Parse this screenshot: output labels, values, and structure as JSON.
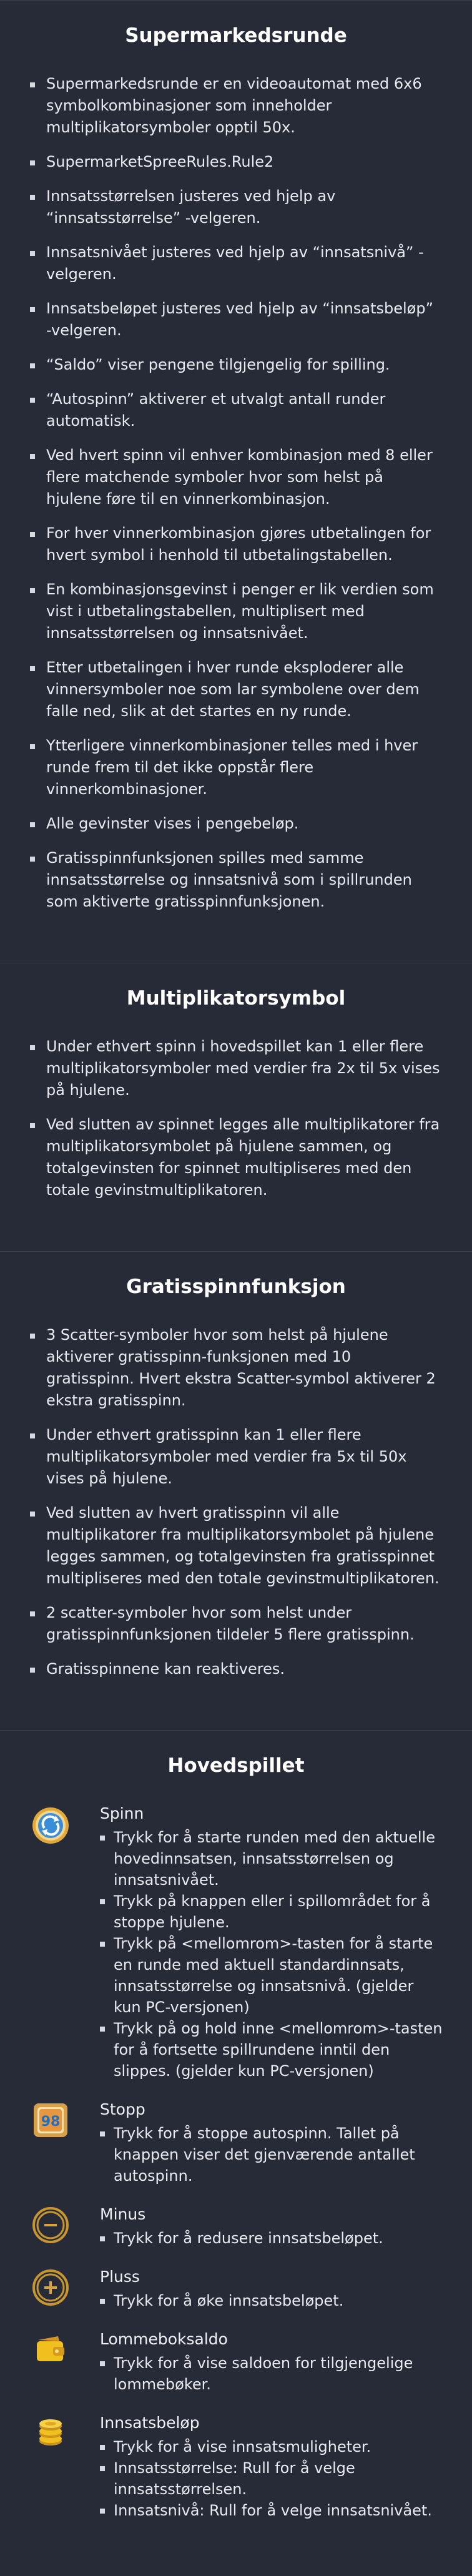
{
  "sections": [
    {
      "title": "Supermarkedsrunde",
      "rules": [
        "Supermarkedsrunde er en videoautomat med 6x6 symbolkombinasjoner som inneholder multiplikatorsymboler opptil 50x.",
        "SupermarketSpreeRules.Rule2",
        "Innsatsstørrelsen justeres ved hjelp av “innsatsstørrelse” -velgeren.",
        "Innsatsnivået justeres ved hjelp av “innsatsnivå” -velgeren.",
        "Innsatsbeløpet justeres ved hjelp av “innsatsbeløp” -velgeren.",
        "“Saldo” viser pengene tilgjengelig for spilling.",
        "“Autospinn” aktiverer et utvalgt antall runder automatisk.",
        "Ved hvert spinn vil enhver kombinasjon med 8 eller flere matchende symboler hvor som helst på hjulene føre til en vinnerkombinasjon.",
        "For hver vinnerkombinasjon gjøres utbetalingen for hvert symbol i henhold til utbetalingstabellen.",
        "En kombinasjonsgevinst i penger er lik verdien som vist i utbetalingstabellen, multiplisert med innsatsstørrelsen og innsatsnivået.",
        "Etter utbetalingen i hver runde eksploderer alle vinnersymboler noe som lar symbolene over dem falle ned, slik at det startes en ny runde.",
        "Ytterligere vinnerkombinasjoner telles med i hver runde frem til det ikke oppstår flere vinnerkombinasjoner.",
        "Alle gevinster vises i pengebeløp.",
        "Gratisspinnfunksjonen spilles med samme innsatsstørrelse og innsatsnivå som i spillrunden som aktiverte gratisspinnfunksjonen."
      ]
    },
    {
      "title": "Multiplikatorsymbol",
      "rules": [
        "Under ethvert spinn i hovedspillet kan 1 eller flere multiplikatorsymboler med verdier fra 2x til 5x vises på hjulene.",
        "Ved slutten av spinnet legges alle multiplikatorer fra multiplikatorsymbolet på hjulene sammen, og totalgevinsten for spinnet multipliseres med den totale gevinstmultiplikatoren."
      ]
    },
    {
      "title": "Gratisspinnfunksjon",
      "rules": [
        "3 Scatter-symboler hvor som helst på hjulene aktiverer gratisspinn-funksjonen med 10 gratisspinn. Hvert ekstra Scatter-symbol aktiverer 2 ekstra gratisspinn.",
        "Under ethvert gratisspinn kan 1 eller flere multiplikatorsymboler med verdier fra 5x til 50x vises på hjulene.",
        "Ved slutten av hvert gratisspinn vil alle multiplikatorer fra multiplikatorsymbolet på hjulene legges sammen, og totalgevinsten fra gratisspinnet multipliseres med den totale gevinstmultiplikatoren.",
        "2 scatter-symboler hvor som helst under gratisspinnfunksjonen tildeler 5 flere gratisspinn.",
        "Gratisspinnene kan reaktiveres."
      ]
    }
  ],
  "main_game": {
    "title": "Hovedspillet",
    "controls": [
      {
        "name": "Spinn",
        "icon": "spin-icon",
        "lines": [
          "Trykk for å starte runden med den aktuelle hovedinnsatsen, innsatsstørrelsen og innsatsnivået.",
          "Trykk på knappen eller i spillområdet for å stoppe hjulene.",
          "Trykk på <mellomrom>-tasten for å starte en runde med aktuell standardinnsats, innsatsstørrelse og innsatsnivå. (gjelder kun PC-versjonen)",
          "Trykk på og hold inne <mellomrom>-tasten for å fortsette spillrundene inntil den slippes. (gjelder kun PC-versjonen)"
        ]
      },
      {
        "name": "Stopp",
        "icon": "autospin-stop-icon",
        "icon_text": "98",
        "lines": [
          "Trykk for å stoppe autospinn. Tallet på knappen viser det gjenværende antallet autospinn."
        ]
      },
      {
        "name": "Minus",
        "icon": "minus-icon",
        "lines": [
          "Trykk for å redusere innsatsbeløpet."
        ]
      },
      {
        "name": "Pluss",
        "icon": "plus-icon",
        "lines": [
          "Trykk for å øke innsatsbeløpet."
        ]
      },
      {
        "name": "Lommeboksaldo",
        "icon": "wallet-icon",
        "lines": [
          "Trykk for å vise saldoen for tilgjengelige lommebøker."
        ]
      },
      {
        "name": "Innsatsbeløp",
        "icon": "coins-icon",
        "lines": [
          "Trykk for å vise innsatsmuligheter.",
          "Innsatsstørrelse: Rull for å velge innsatsstørrelsen.",
          "Innsatsnivå: Rull for å velge innsatsnivået."
        ]
      }
    ]
  },
  "colors": {
    "background": "#272a37",
    "divider": "#3a3d4a",
    "icon_gold": "#e0a93a",
    "icon_yellow": "#f2c01e",
    "spin_blue": "#3a8ed8"
  }
}
